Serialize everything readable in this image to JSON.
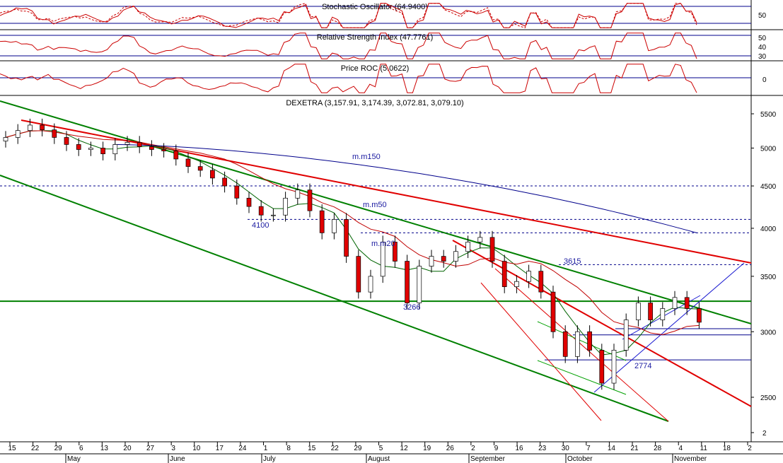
{
  "chart_data": {
    "type": "candlestick",
    "title": "DEXETRA (3,157.91, 3,174.39, 3,072.81, 3,079.10)",
    "subtitle": "",
    "indicators": [
      {
        "name": "Stochastic Oscillator (64.9400)",
        "ticks": [
          "50"
        ]
      },
      {
        "name": "Relative Strength Index (47.7761)",
        "ticks": [
          "50",
          "40",
          "30"
        ]
      },
      {
        "name": "Price ROC (5.0622)",
        "ticks": [
          "0"
        ]
      }
    ],
    "y_ticks": [
      5500,
      5000,
      4500,
      4000,
      3500,
      3000,
      2500,
      2000
    ],
    "y_tick_labels": [
      "5500",
      "5000",
      "4500",
      "4000",
      "3500",
      "3000",
      "2500",
      "2"
    ],
    "x_tick_labels": [
      "15",
      "22",
      "29",
      "6",
      "13",
      "20",
      "27",
      "3",
      "10",
      "17",
      "24",
      "1",
      "8",
      "15",
      "22",
      "29",
      "5",
      "12",
      "19",
      "26",
      "2",
      "9",
      "16",
      "23",
      "30",
      "7",
      "14",
      "21",
      "28",
      "4",
      "11",
      "18",
      "2"
    ],
    "month_labels": [
      "May",
      "June",
      "July",
      "August",
      "September",
      "October",
      "November"
    ],
    "moving_averages": [
      {
        "name": "m.m150",
        "color": "#00008b"
      },
      {
        "name": "m.m50",
        "color": "#c00000"
      },
      {
        "name": "m.m20",
        "color": "#006400"
      }
    ],
    "annotations": [
      "4100",
      "3615",
      "3266",
      "2774"
    ],
    "horizontal_levels": [
      4500,
      4100,
      3950,
      3615,
      3266,
      3025,
      2974,
      2774
    ],
    "closes": [
      5150,
      5250,
      5330,
      5260,
      5150,
      5050,
      4980,
      5000,
      4920,
      5050,
      5080,
      5020,
      4980,
      4960,
      4850,
      4750,
      4700,
      4600,
      4500,
      4350,
      4250,
      4150,
      4150,
      4350,
      4450,
      4200,
      3950,
      4100,
      3700,
      3350,
      3500,
      3850,
      3650,
      3250,
      3600,
      3700,
      3650,
      3750,
      3850,
      3900,
      3650,
      3400,
      3450,
      3550,
      3350,
      3000,
      2800,
      3000,
      2850,
      2600,
      2850,
      3100,
      3250,
      3100,
      3200,
      3300,
      3200,
      3080
    ],
    "colors": {
      "bull": "#ffffff",
      "bear": "#e00000",
      "wick": "#000000",
      "green_line": "#008000",
      "red_line": "#e00000",
      "level": "#00008b",
      "osc": "#cc0000"
    }
  }
}
